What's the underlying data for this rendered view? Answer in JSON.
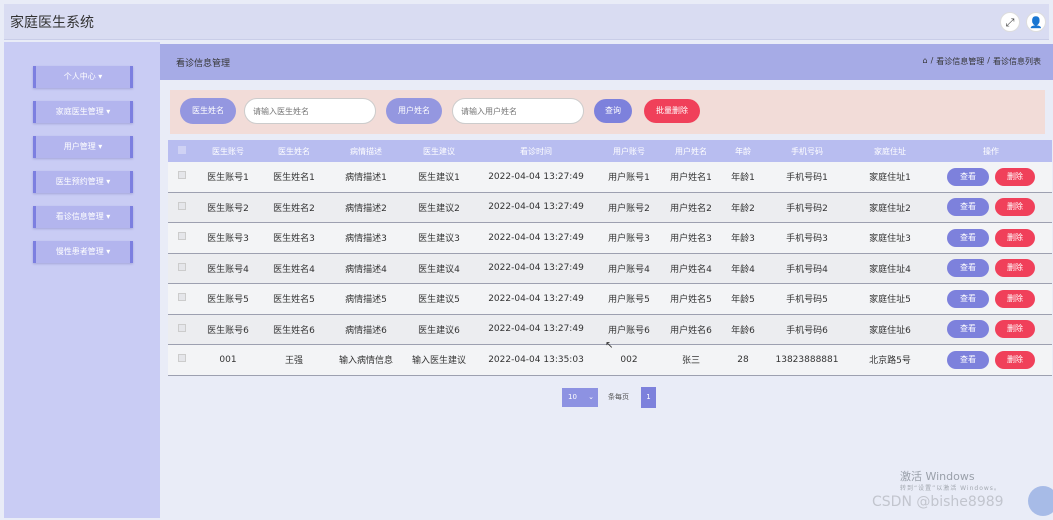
{
  "app": {
    "title": "家庭医生系统"
  },
  "top_icons": {
    "fullscreen": "⤢",
    "user": "👤"
  },
  "sidebar": {
    "items": [
      {
        "label": "个人中心 ▾"
      },
      {
        "label": "家庭医生管理 ▾"
      },
      {
        "label": "用户管理 ▾"
      },
      {
        "label": "医生预约管理 ▾"
      },
      {
        "label": "看诊信息管理 ▾"
      },
      {
        "label": "慢性患者管理 ▾"
      }
    ]
  },
  "header": {
    "title": "看诊信息管理",
    "breadcrumb": [
      "⌂",
      "/",
      "看诊信息管理",
      "/",
      "看诊信息列表"
    ]
  },
  "search": {
    "doctor_name_label": "医生姓名",
    "doctor_name_placeholder": "请输入医生姓名",
    "user_name_label": "用户姓名",
    "user_name_placeholder": "请输入用户姓名",
    "query_button": "查询",
    "batch_delete_button": "批量删除"
  },
  "table": {
    "columns": [
      "医生账号",
      "医生姓名",
      "病情描述",
      "医生建议",
      "看诊时间",
      "用户账号",
      "用户姓名",
      "年龄",
      "手机号码",
      "家庭住址",
      "操作"
    ],
    "rows": [
      [
        "医生账号1",
        "医生姓名1",
        "病情描述1",
        "医生建议1",
        "2022-04-04 13:27:49",
        "用户账号1",
        "用户姓名1",
        "年龄1",
        "手机号码1",
        "家庭住址1"
      ],
      [
        "医生账号2",
        "医生姓名2",
        "病情描述2",
        "医生建议2",
        "2022-04-04 13:27:49",
        "用户账号2",
        "用户姓名2",
        "年龄2",
        "手机号码2",
        "家庭住址2"
      ],
      [
        "医生账号3",
        "医生姓名3",
        "病情描述3",
        "医生建议3",
        "2022-04-04 13:27:49",
        "用户账号3",
        "用户姓名3",
        "年龄3",
        "手机号码3",
        "家庭住址3"
      ],
      [
        "医生账号4",
        "医生姓名4",
        "病情描述4",
        "医生建议4",
        "2022-04-04 13:27:49",
        "用户账号4",
        "用户姓名4",
        "年龄4",
        "手机号码4",
        "家庭住址4"
      ],
      [
        "医生账号5",
        "医生姓名5",
        "病情描述5",
        "医生建议5",
        "2022-04-04 13:27:49",
        "用户账号5",
        "用户姓名5",
        "年龄5",
        "手机号码5",
        "家庭住址5"
      ],
      [
        "医生账号6",
        "医生姓名6",
        "病情描述6",
        "医生建议6",
        "2022-04-04 13:27:49",
        "用户账号6",
        "用户姓名6",
        "年龄6",
        "手机号码6",
        "家庭住址6"
      ],
      [
        "001",
        "王强",
        "输入病情信息",
        "输入医生建议",
        "2022-04-04 13:35:03",
        "002",
        "张三",
        "28",
        "13823888881",
        "北京路5号"
      ]
    ],
    "view_label": "查看",
    "delete_label": "删除"
  },
  "pagination": {
    "page_size": "10",
    "caret": "⌄",
    "total": "条每页",
    "current_page": "1"
  },
  "watermark": {
    "activate": "激活 Windows",
    "activate_sub": "转到“设置”以激活 Windows。",
    "csdn": "CSDN @bishe8989"
  },
  "colors": {
    "sidebar_bg": "#c9ccf4",
    "accent": "#7d81dc",
    "danger": "#f0405a",
    "search_bar_bg": "#f2dcd8"
  }
}
